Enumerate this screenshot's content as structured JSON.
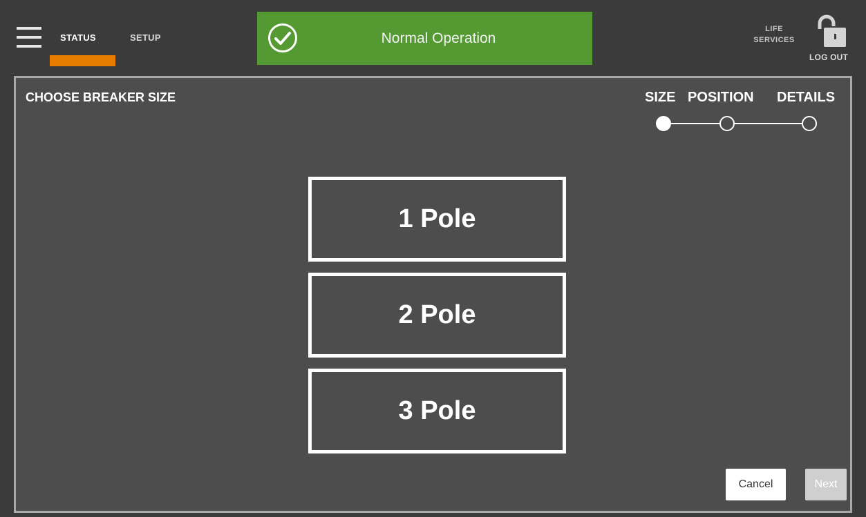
{
  "header": {
    "nav": [
      {
        "label": "STATUS",
        "active": true
      },
      {
        "label": "SETUP",
        "active": false
      }
    ],
    "status_banner": {
      "text": "Normal Operation",
      "icon": "check-circle-icon",
      "color": "#559933"
    },
    "life_services": {
      "line1": "LIFE",
      "line2": "SERVICES"
    },
    "logout_label": "LOG OUT",
    "accent_color": "#e87c00"
  },
  "main": {
    "title": "CHOOSE BREAKER SIZE",
    "steps": [
      {
        "label": "SIZE",
        "complete": true
      },
      {
        "label": "POSITION",
        "complete": false
      },
      {
        "label": "DETAILS",
        "complete": false
      }
    ],
    "options": [
      "1 Pole",
      "2 Pole",
      "3 Pole"
    ],
    "cancel_label": "Cancel",
    "next_label": "Next"
  }
}
